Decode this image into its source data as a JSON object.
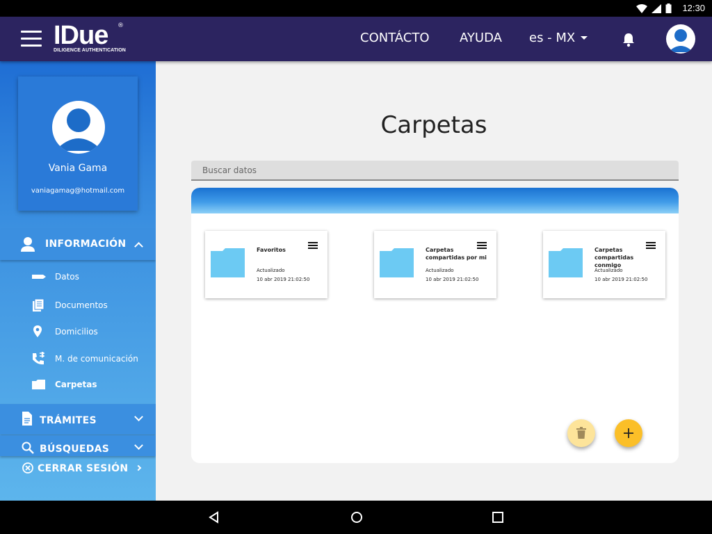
{
  "status_bar": {
    "time": "12:30"
  },
  "header": {
    "logo_text": "IDue",
    "logo_registered": "®",
    "logo_tagline": "DILIGENCE AUTHENTICATION",
    "contact_label": "CONTÁCTO",
    "help_label": "AYUDA",
    "language_label": "es - MX"
  },
  "profile": {
    "name": "Vania Gama",
    "email": "vaniagamag@hotmail.com"
  },
  "sidebar": {
    "informacion_label": "INFORMACIÓN",
    "informacion_items": [
      {
        "label": "Datos",
        "icon": "label-tag-icon"
      },
      {
        "label": "Documentos",
        "icon": "documents-icon"
      },
      {
        "label": "Domicilios",
        "icon": "map-pin-icon"
      },
      {
        "label": "M. de comunicación",
        "icon": "phone-forward-icon"
      },
      {
        "label": "Carpetas",
        "icon": "folder-icon"
      }
    ],
    "tramites_label": "TRÁMITES",
    "busquedas_label": "BÚSQUEDAS",
    "cerrar_label": "CERRAR SESIÓN"
  },
  "main": {
    "title": "Carpetas",
    "search_placeholder": "Buscar datos",
    "folders": [
      {
        "name": "Favoritos",
        "updated_label": "Actualizado",
        "updated_date": "10 abr 2019 21:02:50"
      },
      {
        "name": "Carpetas compartidas por mi",
        "updated_label": "Actualizado",
        "updated_date": "10 abr 2019 21:02:50"
      },
      {
        "name": "Carpetas compartidas conmigo",
        "updated_label": "Actualizado",
        "updated_date": "10 abr 2019 21:02:50"
      }
    ]
  },
  "colors": {
    "header_bg": "#2c2460",
    "sidebar_top": "#1f6ed4",
    "sidebar_bottom": "#5db5ec",
    "folder": "#6ccaf3",
    "fab_add": "#fbbf28",
    "fab_delete": "#fde49a"
  }
}
